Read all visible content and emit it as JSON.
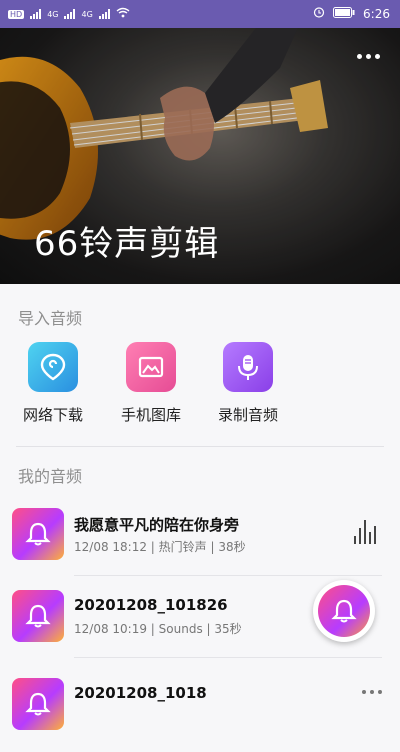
{
  "status_bar": {
    "network_1": "HD",
    "network_2": "4G",
    "network_3": "4G",
    "battery": "",
    "time": "6:26"
  },
  "hero": {
    "title": "66铃声剪辑",
    "more_icon": "more-dots-icon"
  },
  "import_section": {
    "title": "导入音频",
    "items": [
      {
        "label": "网络下载",
        "icon": "download-pin-icon",
        "color": "#3aaee8"
      },
      {
        "label": "手机图库",
        "icon": "gallery-icon",
        "color": "#f06aa6"
      },
      {
        "label": "录制音频",
        "icon": "microphone-icon",
        "color": "#a15cf0"
      }
    ]
  },
  "my_audio": {
    "title": "我的音频",
    "items": [
      {
        "title": "我愿意平凡的陪在你身旁",
        "meta": "12/08 18:12 | 热门铃声 | 38秒",
        "action_icon": "equalizer-icon"
      },
      {
        "title": "20201208_101826",
        "meta": "12/08 10:19 | Sounds | 35秒",
        "action_icon": ""
      },
      {
        "title": "20201208_1018",
        "meta": "",
        "action_icon": "more-dots-icon"
      }
    ]
  },
  "fab": {
    "icon": "bell-icon"
  }
}
